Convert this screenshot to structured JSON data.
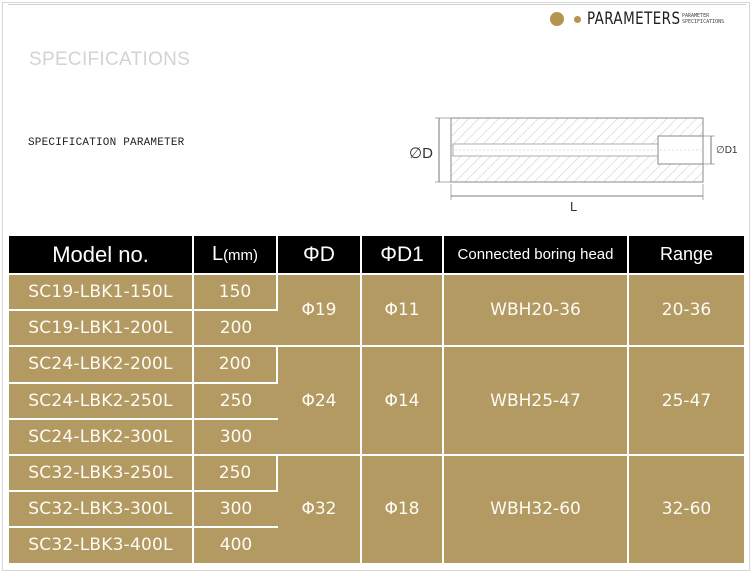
{
  "badge": {
    "title": "PARAMETERS",
    "sub": "PARAMETER SPECIFICATIONS",
    "color": "#b39450"
  },
  "section_title": "SPECIFICATIONS",
  "parameter_label": "SPECIFICATION PARAMETER",
  "diagram": {
    "label_D": "∅D",
    "label_D1": "∅D1",
    "label_L": "L"
  },
  "table": {
    "headers": {
      "model": "Model no.",
      "length_main": "L",
      "length_unit": "(mm)",
      "diameter": "ΦD",
      "diameter_inner": "ΦD1",
      "boring_head": "Connected boring head",
      "range": "Range"
    },
    "groups": [
      {
        "D": "Φ19",
        "D1": "Φ11",
        "boring_head": "WBH20-36",
        "range": "20-36",
        "rows": [
          {
            "model": "SC19-LBK1-150L",
            "L": "150"
          },
          {
            "model": "SC19-LBK1-200L",
            "L": "200"
          }
        ]
      },
      {
        "D": "Φ24",
        "D1": "Φ14",
        "boring_head": "WBH25-47",
        "range": "25-47",
        "rows": [
          {
            "model": "SC24-LBK2-200L",
            "L": "200"
          },
          {
            "model": "SC24-LBK2-250L",
            "L": "250"
          },
          {
            "model": "SC24-LBK2-300L",
            "L": "300"
          }
        ]
      },
      {
        "D": "Φ32",
        "D1": "Φ18",
        "boring_head": "WBH32-60",
        "range": "32-60",
        "rows": [
          {
            "model": "SC32-LBK3-250L",
            "L": "250"
          },
          {
            "model": "SC32-LBK3-300L",
            "L": "300"
          },
          {
            "model": "SC32-LBK3-400L",
            "L": "400"
          }
        ]
      }
    ]
  }
}
